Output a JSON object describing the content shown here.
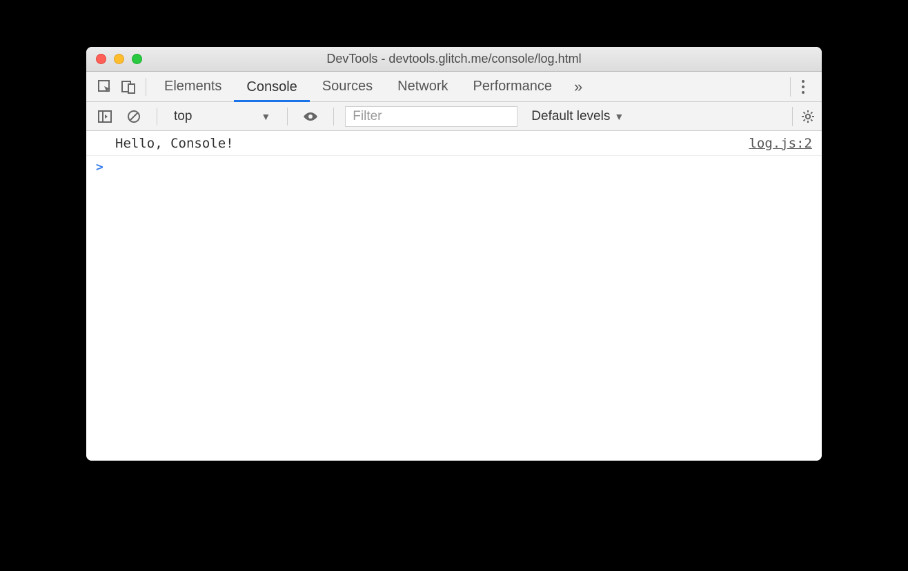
{
  "window": {
    "title": "DevTools - devtools.glitch.me/console/log.html"
  },
  "tabs": {
    "elements": "Elements",
    "console": "Console",
    "sources": "Sources",
    "network": "Network",
    "performance": "Performance"
  },
  "consoleToolbar": {
    "context": "top",
    "filterPlaceholder": "Filter",
    "levels": "Default levels"
  },
  "log": {
    "message": "Hello, Console!",
    "source": "log.js:2"
  },
  "prompt": ">"
}
